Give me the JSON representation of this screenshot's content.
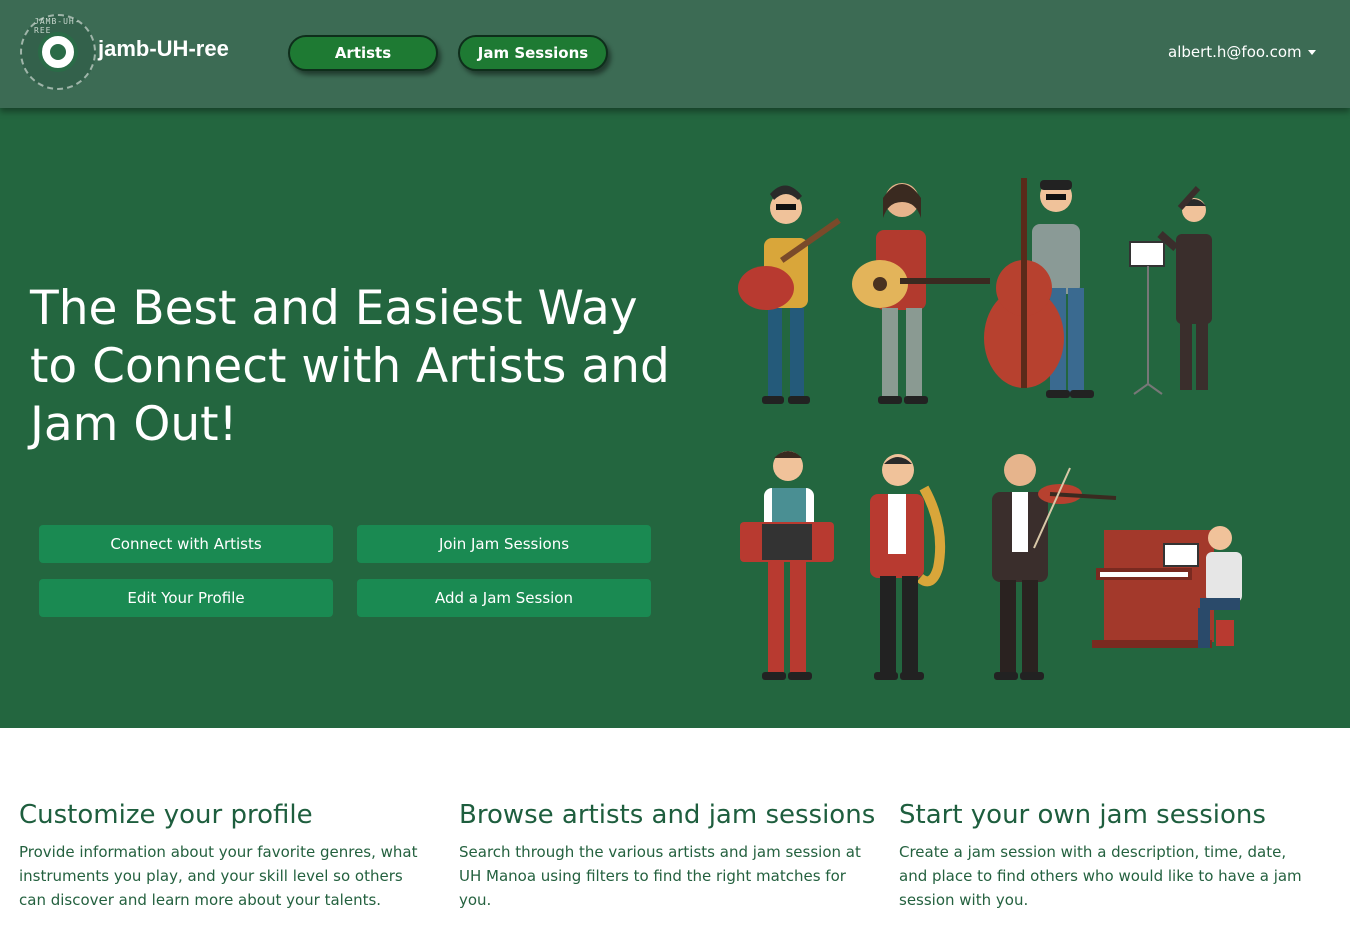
{
  "navbar": {
    "brand": "jamb-UH-ree",
    "logo_text": "JAMB-UH-REE",
    "links": {
      "artists": "Artists",
      "jam_sessions": "Jam Sessions"
    },
    "user_email": "albert.h@foo.com",
    "colors": {
      "bar": "#3c6b54",
      "button": "#1e7a33"
    }
  },
  "hero": {
    "title": "The Best and Easiest Way to Connect with Artists and Jam Out!",
    "buttons": {
      "connect": "Connect with Artists",
      "join": "Join Jam Sessions",
      "edit_profile": "Edit Your Profile",
      "add_session": "Add a Jam Session"
    },
    "illustration_icon": "musicians-illustration",
    "colors": {
      "background": "#23663f",
      "button": "#1a8a52"
    }
  },
  "features": [
    {
      "title": "Customize your profile",
      "text": "Provide information about your favorite genres, what instruments you play, and your skill level so others can discover and learn more about your talents."
    },
    {
      "title": "Browse artists and jam sessions",
      "text": "Search through the various artists and jam session at UH Manoa using filters to find the right matches for you."
    },
    {
      "title": "Start your own jam sessions",
      "text": "Create a jam session with a description, time, date, and place to find others who would like to have a jam session with you."
    }
  ]
}
